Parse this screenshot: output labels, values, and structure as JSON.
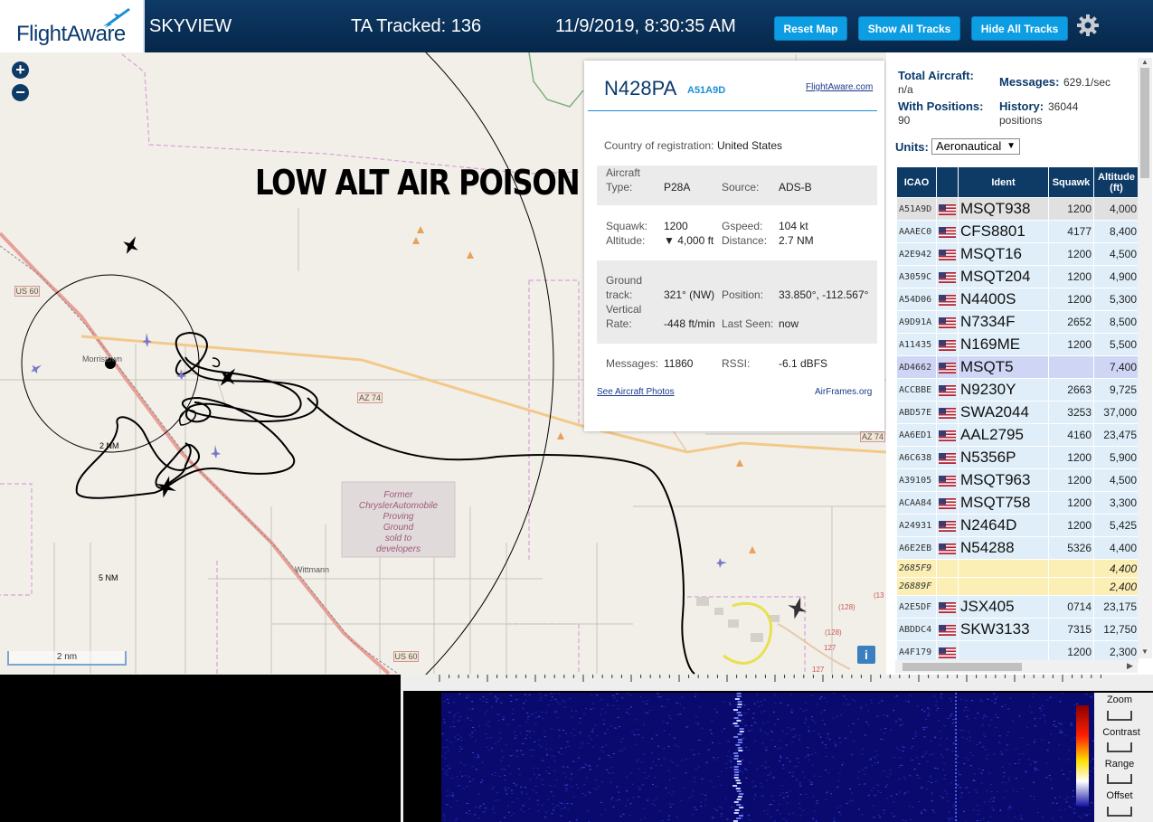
{
  "header": {
    "logo_text": "FlightAware",
    "site_label": "SKYVIEW",
    "ta_tracked": "TA Tracked: 136",
    "datetime": "11/9/2019, 8:30:35 AM",
    "buttons": {
      "reset": "Reset Map",
      "show_all": "Show All Tracks",
      "hide_all": "Hide All Tracks"
    }
  },
  "map": {
    "annotation": "LOW ALT AIR POISON",
    "labels": {
      "us60_a": "US 60",
      "us60_b": "US 60",
      "az74_a": "AZ 74",
      "az74_b": "AZ 74",
      "town": "Morristown",
      "wittmann": "Wittmann",
      "ring2": "2 NM",
      "ring5": "5 NM",
      "chrysler": [
        "Former",
        "ChryslerAutomobile",
        "Proving",
        "Ground",
        "sold to",
        "developers"
      ],
      "r128a": "(128)",
      "r128b": "(128)",
      "r127a": "127",
      "r127b": "127",
      "r13": "(13"
    },
    "scale_label": "2 nm",
    "zoom_in": "+",
    "zoom_out": "−",
    "info_label": "i"
  },
  "popup": {
    "registration": "N428PA",
    "hex": "A51A9D",
    "flightaware_link": "FlightAware.com",
    "country_label": "Country of registration:",
    "country": "United States",
    "aircraft_type_label_1": "Aircraft",
    "aircraft_type_label_2": "Type:",
    "aircraft_type": "P28A",
    "source_label": "Source:",
    "source": "ADS-B",
    "squawk_label": "Squawk:",
    "squawk": "1200",
    "gspeed_label": "Gspeed:",
    "gspeed": "104 kt",
    "altitude_label": "Altitude:",
    "altitude": "▼ 4,000 ft",
    "distance_label": "Distance:",
    "distance": "2.7 NM",
    "ground_label_1": "Ground",
    "ground_label_2": "track:",
    "ground_track": "321° (NW)",
    "position_label": "Position:",
    "position": "33.850°, -112.567°",
    "vrate_label_1": "Vertical",
    "vrate_label_2": "Rate:",
    "vertical_rate": "-448 ft/min",
    "last_seen_label": "Last Seen:",
    "last_seen": "now",
    "messages_label": "Messages:",
    "messages": "11860",
    "rssi_label": "RSSI:",
    "rssi": "-6.1 dBFS",
    "photos_link": "See Aircraft Photos",
    "airframes_link": "AirFrames.org"
  },
  "stats": {
    "total_label": "Total Aircraft:",
    "total_value": "n/a",
    "messages_label": "Messages:",
    "messages_value": "629.1/sec",
    "with_pos_label": "With Positions:",
    "with_pos_value": "90",
    "history_label": "History:",
    "history_value": "36044",
    "history_unit": "positions",
    "units_label": "Units:",
    "units_value": "Aeronautical"
  },
  "table": {
    "headers": {
      "icao": "ICAO",
      "ident": "Ident",
      "squawk": "Squawk",
      "altitude_1": "Altitude",
      "altitude_2": "(ft)"
    },
    "rows": [
      {
        "icao": "A51A9D",
        "ident": "MSQT938",
        "squawk": "1200",
        "altitude": "4,000",
        "flag": true,
        "style": "sel"
      },
      {
        "icao": "AAAEC0",
        "ident": "CFS8801",
        "squawk": "4177",
        "altitude": "8,400",
        "flag": true,
        "style": "row"
      },
      {
        "icao": "A2E942",
        "ident": "MSQT16",
        "squawk": "1200",
        "altitude": "4,500",
        "flag": true,
        "style": "row"
      },
      {
        "icao": "A3059C",
        "ident": "MSQT204",
        "squawk": "1200",
        "altitude": "4,900",
        "flag": true,
        "style": "row"
      },
      {
        "icao": "A54D06",
        "ident": "N4400S",
        "squawk": "1200",
        "altitude": "5,300",
        "flag": true,
        "style": "row"
      },
      {
        "icao": "A9D91A",
        "ident": "N7334F",
        "squawk": "2652",
        "altitude": "8,500",
        "flag": true,
        "style": "row"
      },
      {
        "icao": "A11435",
        "ident": "N169ME",
        "squawk": "1200",
        "altitude": "5,500",
        "flag": true,
        "style": "row"
      },
      {
        "icao": "AD4662",
        "ident": "MSQT5",
        "squawk": "",
        "altitude": "7,400",
        "flag": true,
        "style": "hl"
      },
      {
        "icao": "ACCBBE",
        "ident": "N9230Y",
        "squawk": "2663",
        "altitude": "9,725",
        "flag": true,
        "style": "row"
      },
      {
        "icao": "ABD57E",
        "ident": "SWA2044",
        "squawk": "3253",
        "altitude": "37,000",
        "flag": true,
        "style": "row"
      },
      {
        "icao": "AA6ED1",
        "ident": "AAL2795",
        "squawk": "4160",
        "altitude": "23,475",
        "flag": true,
        "style": "row"
      },
      {
        "icao": "A6C638",
        "ident": "N5356P",
        "squawk": "1200",
        "altitude": "5,900",
        "flag": true,
        "style": "row"
      },
      {
        "icao": "A39105",
        "ident": "MSQT963",
        "squawk": "1200",
        "altitude": "4,500",
        "flag": true,
        "style": "row"
      },
      {
        "icao": "ACAA84",
        "ident": "MSQT758",
        "squawk": "1200",
        "altitude": "3,300",
        "flag": true,
        "style": "row"
      },
      {
        "icao": "A24931",
        "ident": "N2464D",
        "squawk": "1200",
        "altitude": "5,425",
        "flag": true,
        "style": "row"
      },
      {
        "icao": "A6E2EB",
        "ident": "N54288",
        "squawk": "5326",
        "altitude": "4,400",
        "flag": true,
        "style": "row"
      },
      {
        "icao": "2685F9",
        "ident": "",
        "squawk": "",
        "altitude": "4,400",
        "flag": false,
        "style": "nopos"
      },
      {
        "icao": "26889F",
        "ident": "",
        "squawk": "",
        "altitude": "2,400",
        "flag": false,
        "style": "nopos"
      },
      {
        "icao": "A2E5DF",
        "ident": "JSX405",
        "squawk": "0714",
        "altitude": "23,175",
        "flag": true,
        "style": "row"
      },
      {
        "icao": "ABDDC4",
        "ident": "SKW3133",
        "squawk": "7315",
        "altitude": "12,750",
        "flag": true,
        "style": "row"
      },
      {
        "icao": "A4F179",
        "ident": "",
        "squawk": "1200",
        "altitude": "2,300",
        "flag": true,
        "style": "row"
      }
    ]
  },
  "spectrum_controls": {
    "zoom": "Zoom",
    "contrast": "Contrast",
    "range": "Range",
    "offset": "Offset"
  },
  "colors": {
    "header_bg": "#0e3a66",
    "button_bg": "#0d9de3",
    "table_header": "#0e3a66",
    "row_bg": "#dfeef8",
    "nopos_bg": "#fbefb6"
  }
}
